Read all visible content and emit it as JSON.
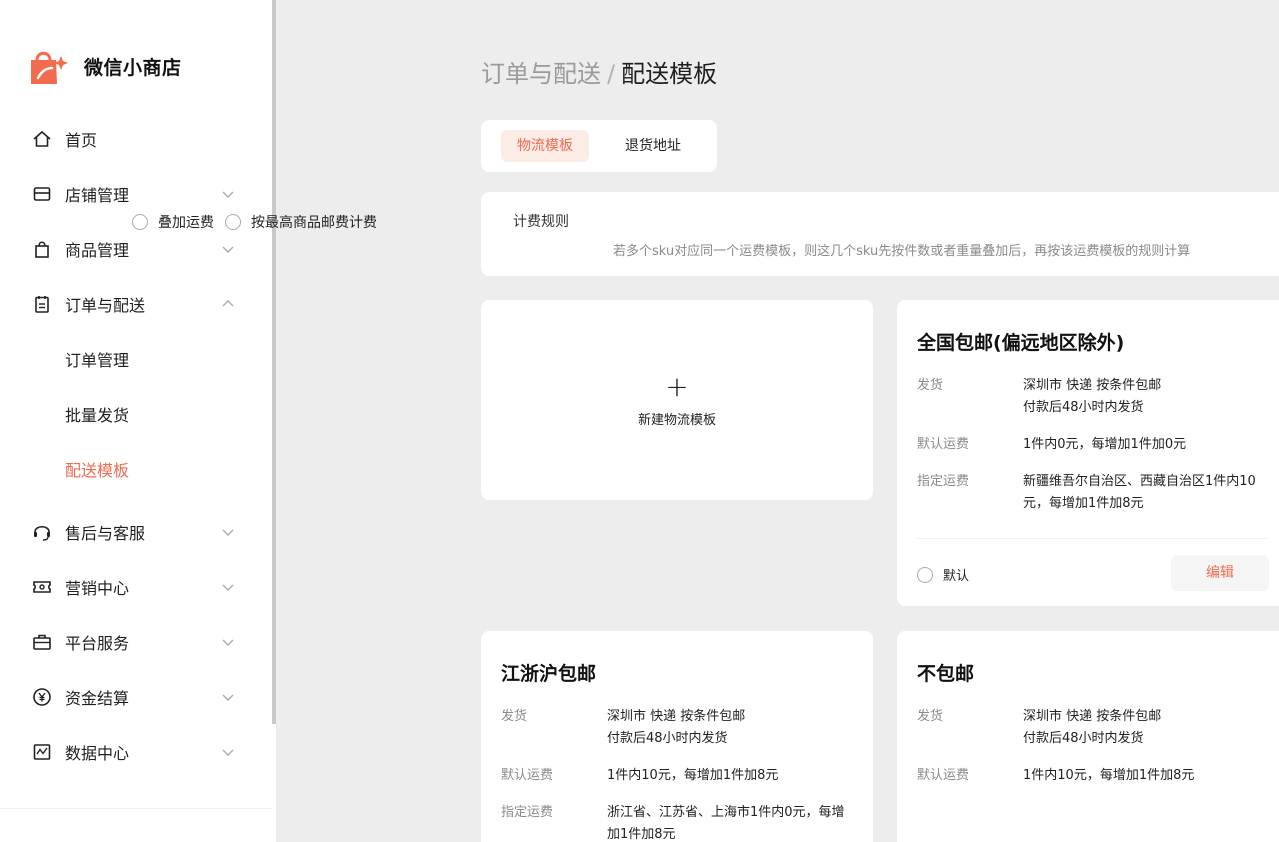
{
  "brand": {
    "name": "微信小商店",
    "accent": "#f26b4f"
  },
  "sidebar": {
    "items": [
      {
        "label": "首页",
        "icon": "home-icon"
      },
      {
        "label": "店铺管理",
        "icon": "store-icon"
      },
      {
        "label": "商品管理",
        "icon": "shopping-bag-icon"
      },
      {
        "label": "订单与配送",
        "icon": "clipboard-icon"
      },
      {
        "label": "订单管理"
      },
      {
        "label": "批量发货"
      },
      {
        "label": "配送模板",
        "active": true
      },
      {
        "label": "售后与客服",
        "icon": "headset-icon"
      },
      {
        "label": "营销中心",
        "icon": "ticket-icon"
      },
      {
        "label": "平台服务",
        "icon": "briefcase-icon"
      },
      {
        "label": "资金结算",
        "icon": "yen-icon"
      },
      {
        "label": "数据中心",
        "icon": "chart-icon"
      }
    ]
  },
  "breadcrumb": {
    "parent": "订单与配送",
    "separator": "/",
    "current": "配送模板"
  },
  "tabs": [
    {
      "label": "物流模板",
      "active": true
    },
    {
      "label": "退货地址",
      "active": false
    }
  ],
  "rule": {
    "label": "计费规则",
    "options": [
      "叠加运费",
      "按最高商品邮费计费"
    ],
    "hint": "若多个sku对应同一个运费模板，则这几个sku先按件数或者重量叠加后，再按该运费模板的规则计算"
  },
  "new_template": {
    "plus": "+",
    "label": "新建物流模板"
  },
  "templates": [
    {
      "title": "全国包邮(偏远地区除外)",
      "ship_key": "发货",
      "ship_line1": "深圳市 快递 按条件包邮",
      "ship_line2": "付款后48小时内发货",
      "default_key": "默认运费",
      "default_val": "1件内0元，每增加1件加0元",
      "special_key": "指定运费",
      "special_val": "新疆维吾尔自治区、西藏自治区1件内10元，每增加1件加8元",
      "default_label": "默认",
      "edit_label": "编辑"
    },
    {
      "title": "江浙沪包邮",
      "ship_key": "发货",
      "ship_line1": "深圳市 快递 按条件包邮",
      "ship_line2": "付款后48小时内发货",
      "default_key": "默认运费",
      "default_val": "1件内10元，每增加1件加8元",
      "special_key": "指定运费",
      "special_val": "浙江省、江苏省、上海市1件内0元，每增加1件加8元"
    },
    {
      "title": "不包邮",
      "ship_key": "发货",
      "ship_line1": "深圳市 快递 按条件包邮",
      "ship_line2": "付款后48小时内发货",
      "default_key": "默认运费",
      "default_val": "1件内10元，每增加1件加8元"
    }
  ]
}
